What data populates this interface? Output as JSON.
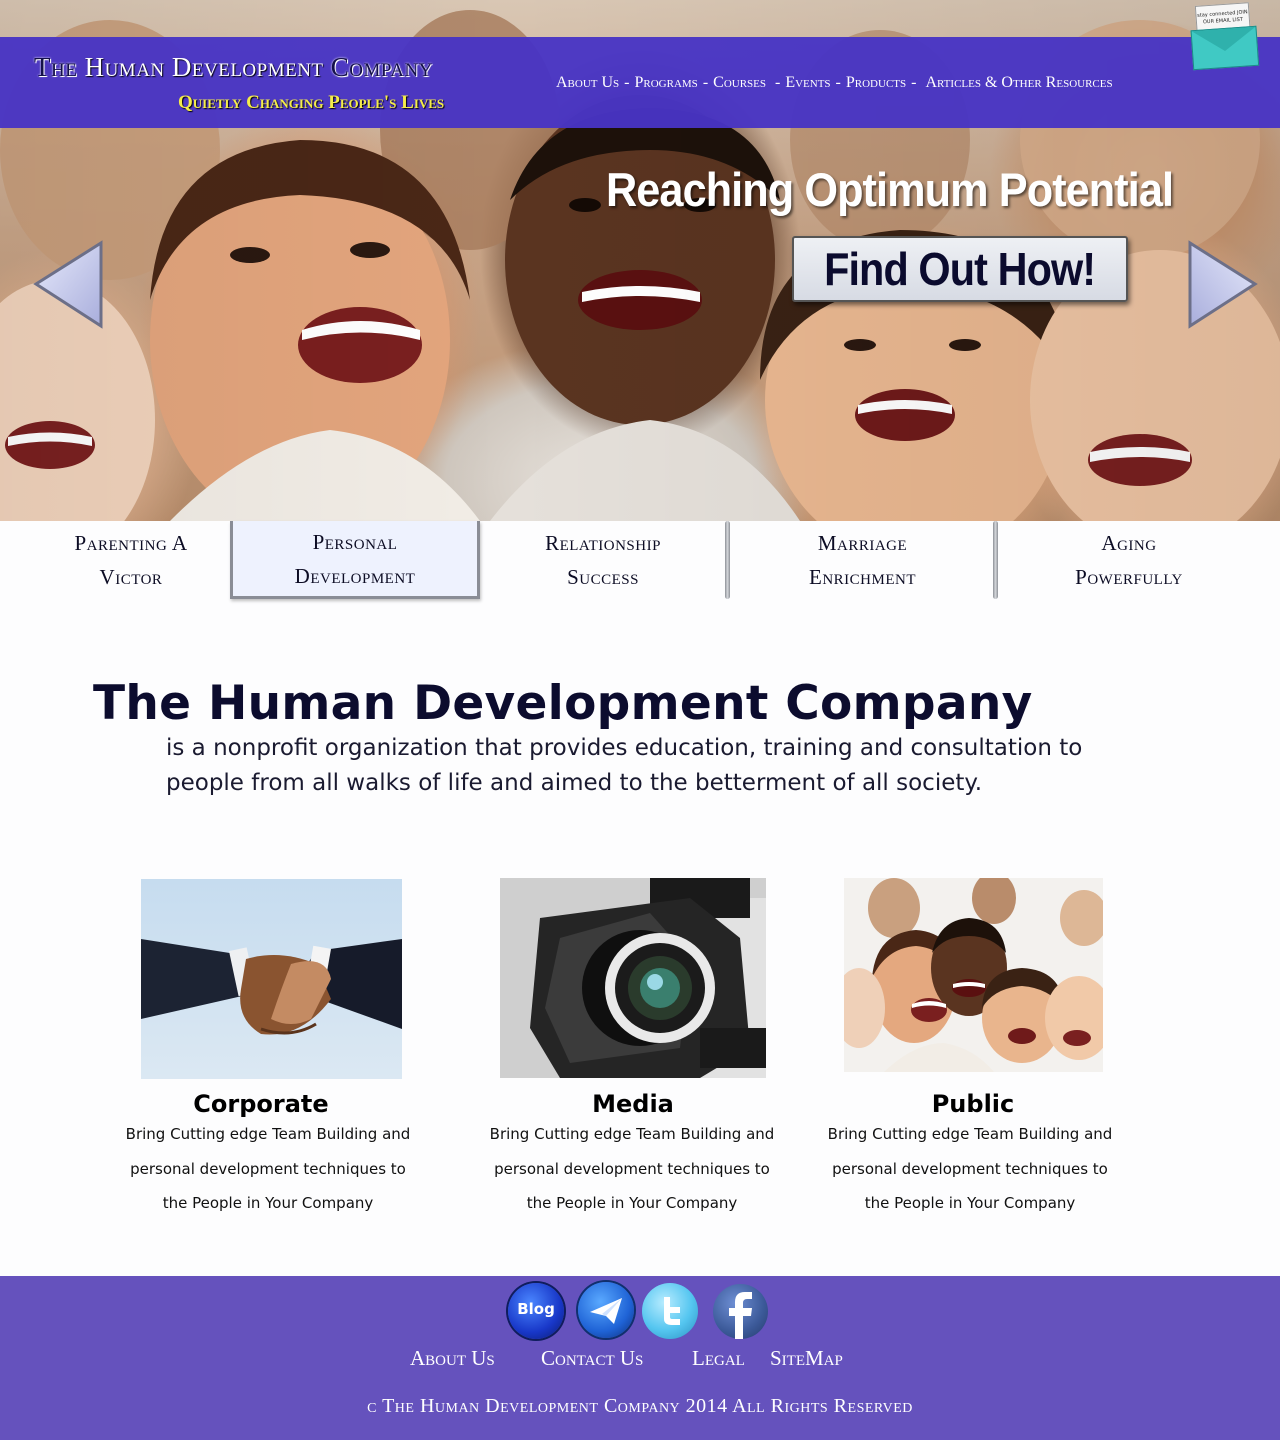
{
  "header": {
    "logo_the": "The",
    "logo_main": "Human Development",
    "logo_company": "Company",
    "tagline": "Quietly Changing People's Lives",
    "nav": [
      {
        "label": "About Us"
      },
      {
        "label": "Programs"
      },
      {
        "label": "Courses"
      },
      {
        "label": "Events"
      },
      {
        "label": "Products"
      },
      {
        "label": "Articles & Other Resources"
      }
    ],
    "separator": "-",
    "email_badge_text": "stay connected JOIN OUR EMAIL LIST"
  },
  "hero": {
    "headline": "Reaching Optimum Potential",
    "cta_label": "Find Out How!"
  },
  "tabs": [
    {
      "line1": "Parenting A",
      "line2": "Victor"
    },
    {
      "line1": "Personal",
      "line2": "Development",
      "active": true
    },
    {
      "line1": "Relationship",
      "line2": "Success"
    },
    {
      "line1": "Marriage",
      "line2": "Enrichment"
    },
    {
      "line1": "Aging",
      "line2": "Powerfully"
    }
  ],
  "about": {
    "heading": "The Human Development Company",
    "description": "is a nonprofit organization that provides education, training and consultation to people from all walks of life and aimed to the betterment of all society."
  },
  "cards": [
    {
      "title": "Corporate",
      "text": "Bring Cutting edge Team Building and personal development techniques to the People in Your Company",
      "image": "handshake-photo"
    },
    {
      "title": "Media",
      "text": "Bring Cutting edge Team Building and personal development techniques to the People in Your Company",
      "image": "video-camera-photo"
    },
    {
      "title": "Public",
      "text": "Bring Cutting edge Team Building and personal development techniques to the People in Your Company",
      "image": "group-people-photo"
    }
  ],
  "footer": {
    "social": [
      {
        "label": "Blog",
        "icon": "blog-icon"
      },
      {
        "icon": "email-icon"
      },
      {
        "icon": "twitter-icon"
      },
      {
        "icon": "facebook-icon"
      }
    ],
    "links": [
      "About Us",
      "Contact Us",
      "Legal",
      "SiteMap"
    ],
    "copyright": "c The Human Development Company 2014 All Rights Reserved"
  },
  "colors": {
    "header_bar": "#4834c4",
    "footer": "#6552bd",
    "tagline": "#f4ec4a",
    "active_tab": "#eef2fe"
  }
}
